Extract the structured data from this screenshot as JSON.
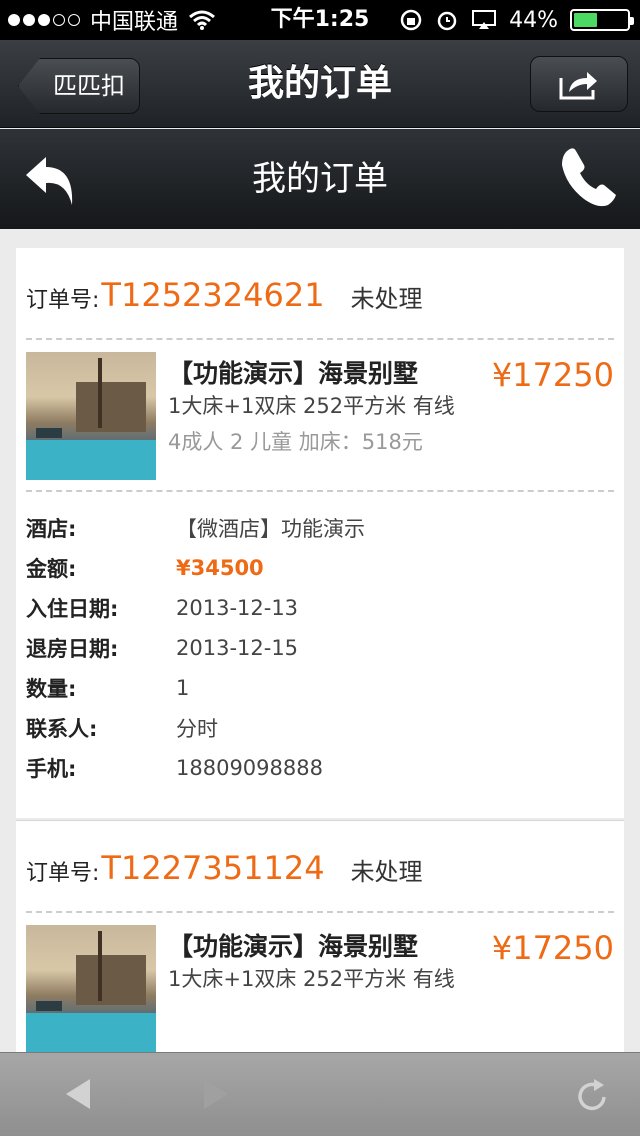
{
  "status_bar": {
    "carrier": "中国联通",
    "time": "下午1:25",
    "battery_percent": "44%",
    "battery_level": 0.44
  },
  "navbar": {
    "back_label": "匹匹扣",
    "title": "我的订单"
  },
  "subnav": {
    "title": "我的订单"
  },
  "orders": [
    {
      "order_label": "订单号:",
      "order_no": "T1252324621",
      "status": "未处理",
      "item": {
        "name": "【功能演示】海景别墅",
        "room_info": "1大床+1双床 252平方米 有线",
        "guests": "4成人 2 儿童  加床：518元",
        "price": "¥17250"
      },
      "details": [
        {
          "key": "酒店:",
          "value": "【微酒店】功能演示"
        },
        {
          "key": "金额:",
          "value": "¥34500"
        },
        {
          "key": "入住日期:",
          "value": "2013-12-13"
        },
        {
          "key": "退房日期:",
          "value": "2013-12-15"
        },
        {
          "key": "数量:",
          "value": "1"
        },
        {
          "key": "联系人:",
          "value": "分时"
        },
        {
          "key": "手机:",
          "value": "18809098888"
        }
      ]
    },
    {
      "order_label": "订单号:",
      "order_no": "T1227351124",
      "status": "未处理",
      "item": {
        "name": "【功能演示】海景别墅",
        "room_info": "1大床+1双床 252平方米 有线",
        "price": "¥17250"
      }
    }
  ],
  "colors": {
    "accent": "#ee6a15",
    "battery": "#4cd964"
  },
  "icons": [
    "wifi-icon",
    "lock-rotation-icon",
    "alarm-icon",
    "airplay-icon",
    "share-icon",
    "back-arrow-icon",
    "phone-icon",
    "back-icon",
    "forward-icon",
    "refresh-icon"
  ]
}
